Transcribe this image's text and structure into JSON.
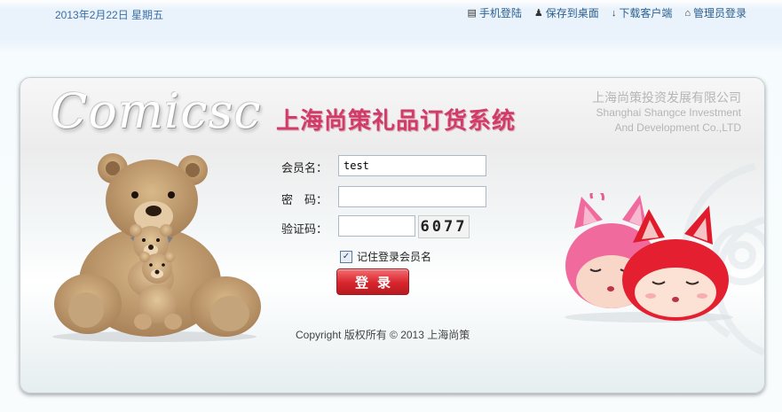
{
  "header": {
    "date": "2013年2月22日  星期五",
    "links": [
      {
        "icon": "mobile-icon",
        "glyph": "▤",
        "label": "手机登陆"
      },
      {
        "icon": "user-icon",
        "glyph": "♟",
        "label": "保存到桌面"
      },
      {
        "icon": "download-icon",
        "glyph": "↓",
        "label": "下载客户端"
      },
      {
        "icon": "home-icon",
        "glyph": "⌂",
        "label": "管理员登录"
      }
    ]
  },
  "brand": {
    "logo_text": "Comicsc",
    "system_title": "上海尚策礼品订货系统",
    "company_cn": "上海尚策投资发展有限公司",
    "company_en_1": "Shanghai Shangce Investment",
    "company_en_2": "And Development Co.,LTD"
  },
  "login": {
    "username_label": "会员名：",
    "username_value": "test",
    "password_label": "密　码：",
    "password_value": "",
    "captcha_label": "验证码：",
    "captcha_value": "",
    "captcha_image_text": "6077",
    "remember_checked": true,
    "remember_label": "记住登录会员名",
    "submit_label": "登录"
  },
  "footer": {
    "copyright": "Copyright  版权所有  © 2013  上海尚策"
  },
  "colors": {
    "title_pink": "#d23a68",
    "button_red": "#d7242c",
    "link_blue": "#2c5f8f"
  }
}
